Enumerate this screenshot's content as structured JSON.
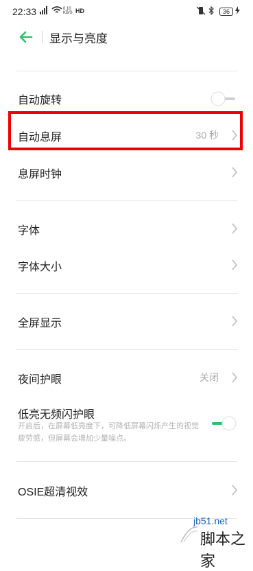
{
  "status_bar": {
    "time": "22:33",
    "net_speed_value": "0.10",
    "net_speed_unit": "KB/S",
    "hd_label": "HD",
    "battery": "36"
  },
  "header": {
    "title": "显示与亮度"
  },
  "settings": {
    "auto_rotate": {
      "label": "自动旋转",
      "enabled": false
    },
    "auto_screen_off": {
      "label": "自动息屏",
      "value": "30 秒"
    },
    "screen_off_clock": {
      "label": "息屏时钟"
    },
    "font": {
      "label": "字体"
    },
    "font_size": {
      "label": "字体大小"
    },
    "fullscreen": {
      "label": "全屏显示"
    },
    "night_mode": {
      "label": "夜间护眼",
      "value": "关闭"
    },
    "low_light_flicker": {
      "label": "低亮无频闪护眼",
      "description": "开启后，在屏幕低亮度下，可降低屏幕闪烁产生的视觉疲劳感，但屏幕会增加少量噪点。",
      "enabled": true
    },
    "osie": {
      "label": "OSIE超清视效"
    }
  },
  "watermark": {
    "site": "jb51.net",
    "brand": "脚本之家"
  },
  "colors": {
    "accent": "#2fbf71",
    "highlight_border": "#ee0000"
  }
}
